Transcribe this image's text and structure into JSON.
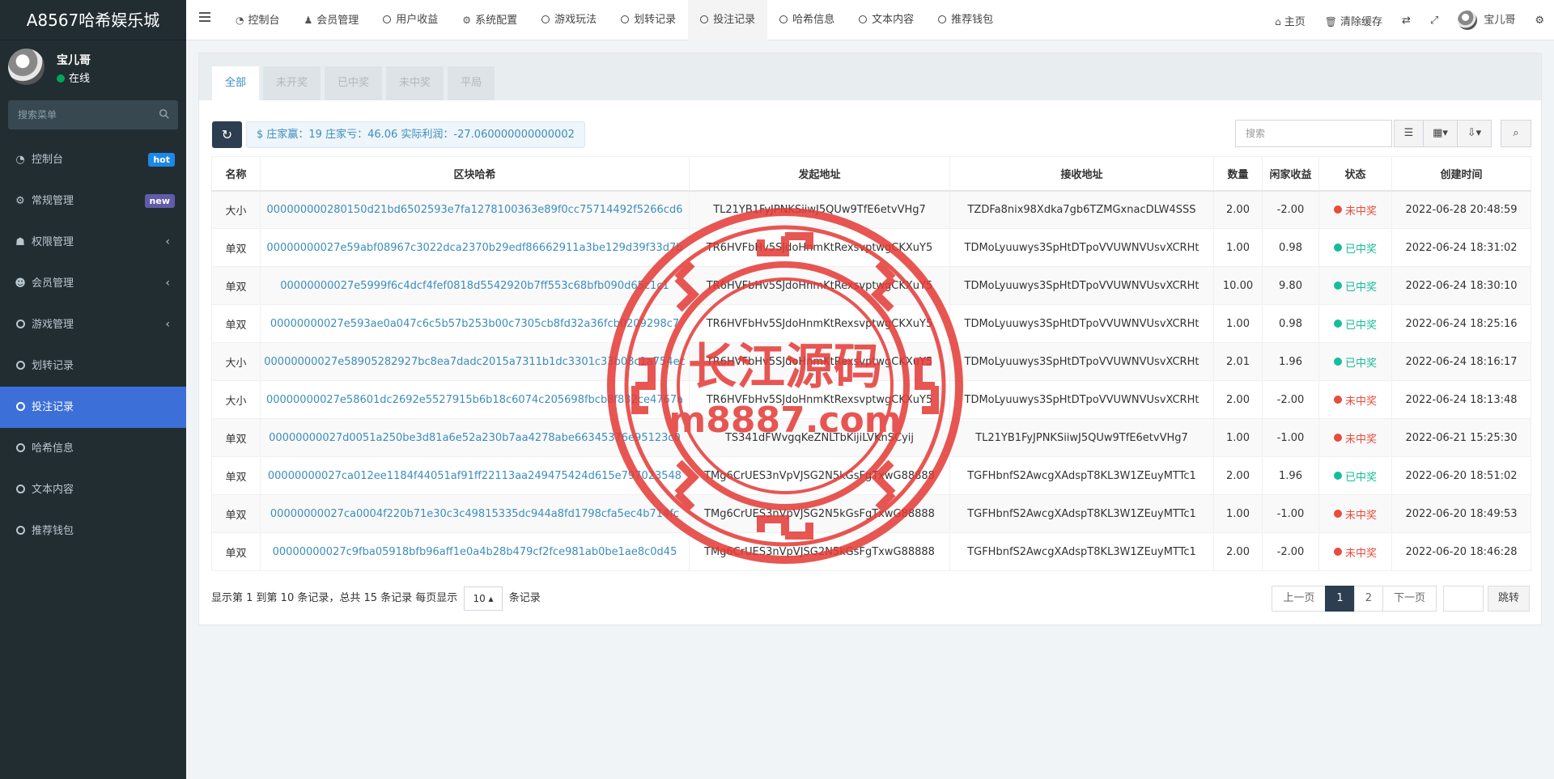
{
  "app": {
    "title": "A8567哈希娱乐城"
  },
  "user": {
    "name": "宝儿哥",
    "status": "在线"
  },
  "sidebar": {
    "search_placeholder": "搜索菜单",
    "items": [
      {
        "label": "控制台",
        "badge": "hot"
      },
      {
        "label": "常规管理",
        "badge": "new"
      },
      {
        "label": "权限管理"
      },
      {
        "label": "会员管理"
      },
      {
        "label": "游戏管理"
      },
      {
        "label": "划转记录"
      },
      {
        "label": "投注记录"
      },
      {
        "label": "哈希信息"
      },
      {
        "label": "文本内容"
      },
      {
        "label": "推荐钱包"
      }
    ]
  },
  "topnav": {
    "tabs": [
      "控制台",
      "会员管理",
      "用户收益",
      "系统配置",
      "游戏玩法",
      "划转记录",
      "投注记录",
      "哈希信息",
      "文本内容",
      "推荐钱包"
    ],
    "home": "主页",
    "clear_cache": "清除缓存",
    "user": "宝儿哥"
  },
  "filter_tabs": [
    "全部",
    "未开奖",
    "已中奖",
    "未中奖",
    "平局"
  ],
  "stats_text": "$ 庄家赢：19 庄家亏：46.06 实际利润：-27.060000000000002",
  "search_placeholder": "搜索",
  "table": {
    "headers": [
      "名称",
      "区块哈希",
      "发起地址",
      "接收地址",
      "数量",
      "闲家收益",
      "状态",
      "创建时间"
    ],
    "rows": [
      [
        "大小",
        "000000000280150d21bd6502593e7fa1278100363e89f0cc75714492f5266cd6",
        "TL21YB1FyJPNKSiiwJ5QUw9TfE6etvVHg7",
        "TZDFa8nix98Xdka7gb6TZMGxnacDLW4SSS",
        "2.00",
        "-2.00",
        "未中奖",
        "2022-06-28 20:48:59"
      ],
      [
        "单双",
        "00000000027e59abf08967c3022dca2370b29edf86662911a3be129d39f33d7b",
        "TR6HVFbHv5SJdoHnmKtRexsvptwgCKXuY5",
        "TDMoLyuuwys3SpHtDTpoVVUWNVUsvXCRHt",
        "1.00",
        "0.98",
        "已中奖",
        "2022-06-24 18:31:02"
      ],
      [
        "单双",
        "00000000027e5999f6c4dcf4fef0818d5542920b7ff553c68bfb090d65c1c1",
        "TR6HVFbHv5SJdoHnmKtRexsvptwgCKXuY5",
        "TDMoLyuuwys3SpHtDTpoVVUWNVUsvXCRHt",
        "10.00",
        "9.80",
        "已中奖",
        "2022-06-24 18:30:10"
      ],
      [
        "单双",
        "00000000027e593ae0a047c6c5b57b253b00c7305cb8fd32a36fcb0209298c7",
        "TR6HVFbHv5SJdoHnmKtRexsvptwgCKXuY5",
        "TDMoLyuuwys3SpHtDTpoVVUWNVUsvXCRHt",
        "1.00",
        "0.98",
        "已中奖",
        "2022-06-24 18:25:16"
      ],
      [
        "大小",
        "00000000027e58905282927bc8ea7dadc2015a7311b1dc3301c33b08c1a754ec",
        "TR6HVFbHv5SJdoHnmKtRexsvptwgCKXuY5",
        "TDMoLyuuwys3SpHtDTpoVVUWNVUsvXCRHt",
        "2.01",
        "1.96",
        "已中奖",
        "2022-06-24 18:16:17"
      ],
      [
        "大小",
        "00000000027e58601dc2692e5527915b6b18c6074c205698fbcb8f832ce4767a",
        "TR6HVFbHv5SJdoHnmKtRexsvptwgCKXuY5",
        "TDMoLyuuwys3SpHtDTpoVVUWNVUsvXCRHt",
        "2.00",
        "-2.00",
        "未中奖",
        "2022-06-24 18:13:48"
      ],
      [
        "单双",
        "00000000027d0051a250be3d81a6e52a230b7aa4278abe66345376e95123c0",
        "TS341dFWvgqKeZNLTbKijiLVKnSCyij",
        "TL21YB1FyJPNKSiiwJ5QUw9TfE6etvVHg7",
        "1.00",
        "-1.00",
        "未中奖",
        "2022-06-21 15:25:30"
      ],
      [
        "单双",
        "00000000027ca012ee1184f44051af91ff22113aa249475424d615e797023548",
        "TMg6CrUES3nVpVJSG2N5kGsFgTxwG88888",
        "TGFHbnfS2AwcgXAdspT8KL3W1ZEuyMTTc1",
        "2.00",
        "1.96",
        "已中奖",
        "2022-06-20 18:51:02"
      ],
      [
        "单双",
        "00000000027ca0004f220b71e30c3c49815335dc944a8fd1798cfa5ec4b714fc",
        "TMg6CrUES3nVpVJSG2N5kGsFgTxwG88888",
        "TGFHbnfS2AwcgXAdspT8KL3W1ZEuyMTTc1",
        "1.00",
        "-1.00",
        "未中奖",
        "2022-06-20 18:49:53"
      ],
      [
        "单双",
        "00000000027c9fba05918bfb96aff1e0a4b28b479cf2fce981ab0be1ae8c0d45",
        "TMg6CrUES3nVpVJSG2N5kGsFgTxwG88888",
        "TGFHbnfS2AwcgXAdspT8KL3W1ZEuyMTTc1",
        "2.00",
        "-2.00",
        "未中奖",
        "2022-06-20 18:46:28"
      ]
    ]
  },
  "pagination": {
    "info_prefix": "显示第 1 到第 10 条记录，总共 15 条记录 每页显示",
    "page_size": "10",
    "info_suffix": "条记录",
    "prev": "上一页",
    "pages": [
      "1",
      "2"
    ],
    "next": "下一页",
    "go": "跳转"
  },
  "watermark": {
    "title": "长江源码",
    "url": "m8887.com"
  },
  "colors": {
    "accent": "#3c6fd8",
    "sidebar_bg": "#222d32",
    "win": "#18bc9c",
    "lose": "#e74c3c",
    "link": "#3c8dbc",
    "stamp": "#e53935"
  }
}
